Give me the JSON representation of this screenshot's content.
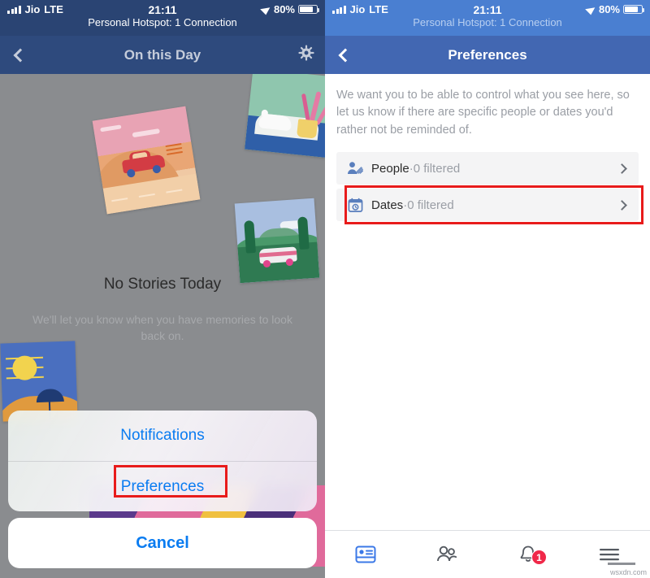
{
  "status_bar": {
    "carrier": "Jio",
    "network": "LTE",
    "time": "21:11",
    "battery_percent": "80%",
    "hotspot": "Personal Hotspot: 1 Connection"
  },
  "left_screen": {
    "nav": {
      "title": "On this Day",
      "back_icon": "chevron-left-icon",
      "settings_icon": "gear-icon"
    },
    "empty_state": {
      "title": "No Stories Today",
      "subtitle": "We'll let you know when you have memories to look back on."
    },
    "action_sheet": {
      "items": [
        {
          "label": "Notifications",
          "highlighted": false
        },
        {
          "label": "Preferences",
          "highlighted": true
        }
      ],
      "cancel_label": "Cancel"
    }
  },
  "right_screen": {
    "nav": {
      "title": "Preferences",
      "back_icon": "chevron-left-icon"
    },
    "intro": "We want you to be able to control what you see here, so let us know if there are specific people or dates you'd rather not be reminded of.",
    "rows": [
      {
        "label": "People",
        "separator": " · ",
        "detail": "0 filtered",
        "icon": "people-filter-icon",
        "highlighted": false
      },
      {
        "label": "Dates",
        "separator": " · ",
        "detail": "0 filtered",
        "icon": "calendar-clock-icon",
        "highlighted": true
      }
    ],
    "tab_bar": [
      {
        "name": "news-feed",
        "icon": "news-feed-icon",
        "active": true,
        "badge": ""
      },
      {
        "name": "friends",
        "icon": "friends-icon",
        "active": false,
        "badge": ""
      },
      {
        "name": "notifications",
        "icon": "bell-icon",
        "active": false,
        "badge": "1"
      },
      {
        "name": "menu",
        "icon": "hamburger-menu-icon",
        "active": false,
        "badge": ""
      }
    ]
  },
  "watermark": "wsxdn.com",
  "colors": {
    "fb_blue": "#4267b2",
    "status_blue_right": "#4a7fd1",
    "nav_dimmed": "#2e4a7d",
    "link_blue": "#0a7cf1",
    "highlight_red": "#e81b1b",
    "badge_red": "#f02849",
    "row_gray": "#f4f4f5",
    "muted_text": "#9a9ea5"
  }
}
